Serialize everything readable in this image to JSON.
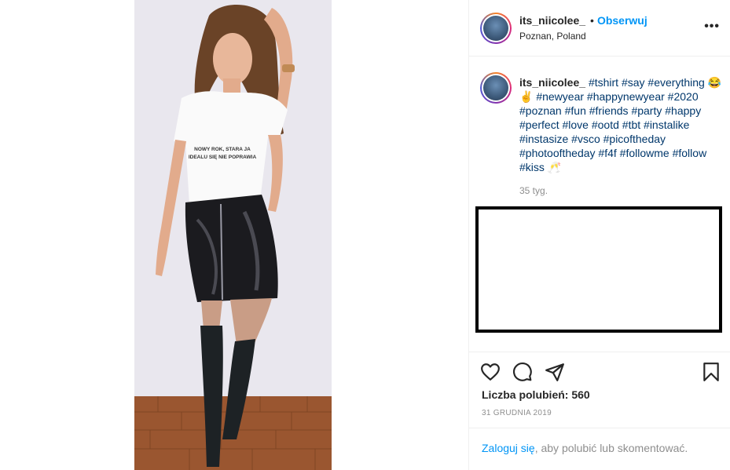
{
  "post": {
    "username": "its_niicolee_",
    "separator": "•",
    "follow_label": "Obserwuj",
    "location": "Poznan, Poland",
    "more_icon": "more-horizontal-icon",
    "shirt_text": [
      "NOWY ROK, STARA JA",
      "IDEALU SIĘ NIE POPRAWIA"
    ]
  },
  "caption": {
    "username": "its_niicolee_",
    "segments": [
      {
        "text": "#tshirt",
        "type": "tag"
      },
      {
        "text": " ",
        "type": "plain"
      },
      {
        "text": "#say",
        "type": "tag"
      },
      {
        "text": " ",
        "type": "plain"
      },
      {
        "text": "#everything",
        "type": "tag"
      },
      {
        "text": " 😂✌ ",
        "type": "plain"
      },
      {
        "text": "#newyear",
        "type": "tag"
      },
      {
        "text": " ",
        "type": "plain"
      },
      {
        "text": "#happynewyear",
        "type": "tag"
      },
      {
        "text": " ",
        "type": "plain"
      },
      {
        "text": "#2020",
        "type": "tag"
      },
      {
        "text": " ",
        "type": "plain"
      },
      {
        "text": "#poznan",
        "type": "tag"
      },
      {
        "text": " ",
        "type": "plain"
      },
      {
        "text": "#fun",
        "type": "tag"
      },
      {
        "text": " ",
        "type": "plain"
      },
      {
        "text": "#friends",
        "type": "tag"
      },
      {
        "text": " ",
        "type": "plain"
      },
      {
        "text": "#party",
        "type": "tag"
      },
      {
        "text": " ",
        "type": "plain"
      },
      {
        "text": "#happy",
        "type": "tag"
      },
      {
        "text": " ",
        "type": "plain"
      },
      {
        "text": "#perfect",
        "type": "tag"
      },
      {
        "text": " ",
        "type": "plain"
      },
      {
        "text": "#love",
        "type": "tag"
      },
      {
        "text": " ",
        "type": "plain"
      },
      {
        "text": "#ootd",
        "type": "tag"
      },
      {
        "text": " ",
        "type": "plain"
      },
      {
        "text": "#tbt",
        "type": "tag"
      },
      {
        "text": " ",
        "type": "plain"
      },
      {
        "text": "#instalike",
        "type": "tag"
      },
      {
        "text": " ",
        "type": "plain"
      },
      {
        "text": "#instasize",
        "type": "tag"
      },
      {
        "text": " ",
        "type": "plain"
      },
      {
        "text": "#vsco",
        "type": "tag"
      },
      {
        "text": " ",
        "type": "plain"
      },
      {
        "text": "#picoftheday",
        "type": "tag"
      },
      {
        "text": " ",
        "type": "plain"
      },
      {
        "text": "#photooftheday",
        "type": "tag"
      },
      {
        "text": " ",
        "type": "plain"
      },
      {
        "text": "#f4f",
        "type": "tag"
      },
      {
        "text": " ",
        "type": "plain"
      },
      {
        "text": "#followme",
        "type": "tag"
      },
      {
        "text": " ",
        "type": "plain"
      },
      {
        "text": "#follow",
        "type": "tag"
      },
      {
        "text": " ",
        "type": "plain"
      },
      {
        "text": "#kiss",
        "type": "tag"
      },
      {
        "text": " 🥂",
        "type": "plain"
      }
    ],
    "time_ago": "35 tyg."
  },
  "actions": {
    "icons": [
      "heart-icon",
      "comment-icon",
      "share-icon",
      "bookmark-icon"
    ],
    "likes_label": "Liczba polubień: ",
    "likes_count": "560",
    "date": "31 GRUDNIA 2019"
  },
  "login": {
    "link": "Zaloguj się",
    "rest": ", aby polubić lub skomentować."
  },
  "colors": {
    "link_blue": "#0095f6",
    "hashtag": "#00376b",
    "muted": "#8e8e8e",
    "border": "#efefef"
  }
}
